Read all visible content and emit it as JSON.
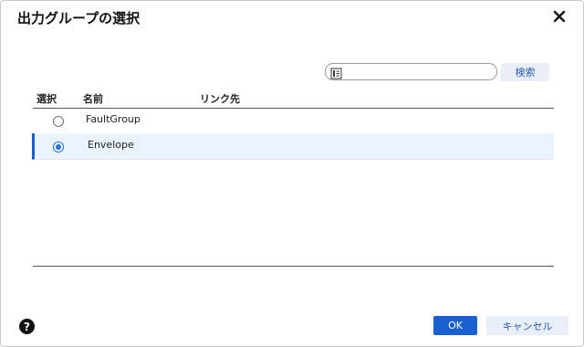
{
  "dialog": {
    "title": "出力グループの選択"
  },
  "search": {
    "value": "",
    "placeholder": "",
    "button_label": "検索",
    "icon": "list-icon"
  },
  "table": {
    "headers": {
      "select": "選択",
      "name": "名前",
      "link_target": "リンク先"
    },
    "rows": [
      {
        "name": "FaultGroup",
        "link_target": "",
        "selected": false
      },
      {
        "name": "Envelope",
        "link_target": "",
        "selected": true
      }
    ]
  },
  "footer": {
    "help_label": "?",
    "ok_label": "OK",
    "cancel_label": "キャンセル"
  },
  "colors": {
    "accent": "#1a5fcf",
    "selected_row_bg": "#eaf2fd",
    "secondary_button_bg": "#e9eff8"
  }
}
